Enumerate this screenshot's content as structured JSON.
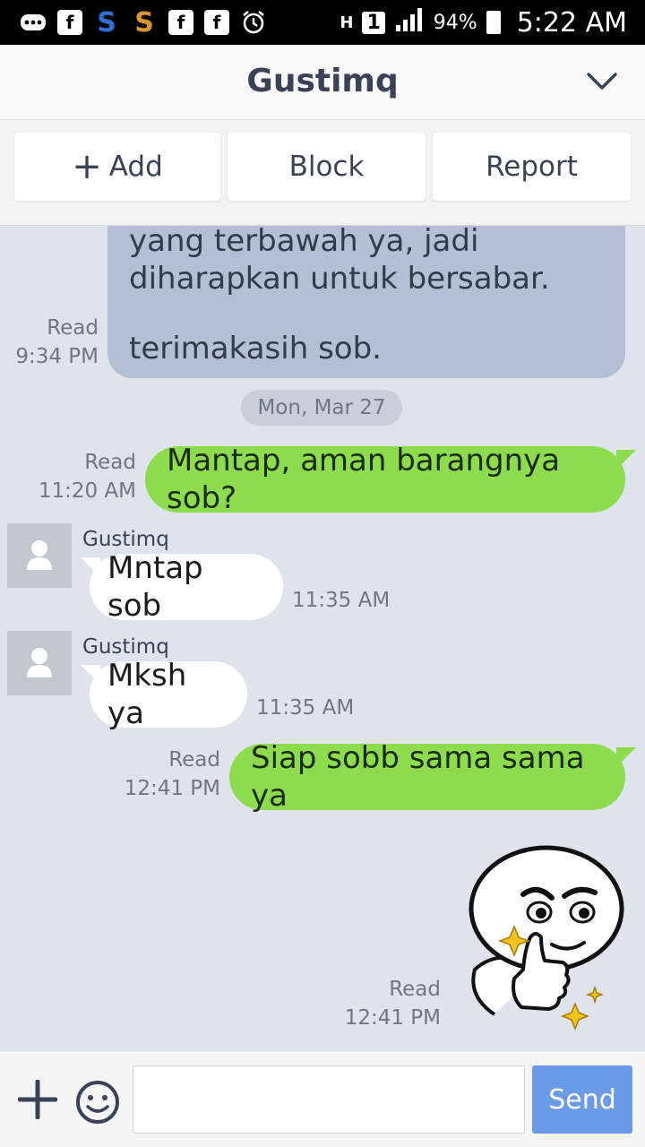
{
  "status_bar": {
    "battery": "94%",
    "time": "5:22 AM",
    "icons": [
      "more-icon",
      "facebook-icon",
      "s-app-icon",
      "s-app-icon",
      "facebook-icon",
      "facebook-icon",
      "alarm-icon",
      "data-icon",
      "sim-icon",
      "signal-icon",
      "battery-icon"
    ],
    "sim": "1",
    "network_letter": "H"
  },
  "header": {
    "title": "Gustimq",
    "chevron": "chevron-down-icon"
  },
  "actions": {
    "add_label": "Add",
    "block_label": "Block",
    "report_label": "Report"
  },
  "chat": {
    "previous_message": {
      "line1": "yang terbawah ya, jadi",
      "line2": "diharapkan untuk bersabar.",
      "line3": "terimakasih sob.",
      "read": "Read",
      "time": "9:34 PM"
    },
    "date_separator": "Mon, Mar 27",
    "messages": [
      {
        "from": "me",
        "text": "Mantap, aman barangnya sob?",
        "read": "Read",
        "time": "11:20 AM"
      },
      {
        "from": "Gustimq",
        "text": "Mntap sob",
        "time": "11:35 AM"
      },
      {
        "from": "Gustimq",
        "text": "Mksh ya",
        "time": "11:35 AM"
      },
      {
        "from": "me",
        "text": "Siap sobb sama sama ya",
        "read": "Read",
        "time": "12:41 PM"
      },
      {
        "from": "me",
        "type": "sticker",
        "sticker": "thumbs-up-sticker",
        "read": "Read",
        "time": "12:41 PM"
      }
    ]
  },
  "input_bar": {
    "placeholder": "",
    "send_label": "Send"
  },
  "colors": {
    "chat_background": "#dfe3eb",
    "outgoing_bubble": "#8ddc4d",
    "incoming_bubble": "#ffffff",
    "previous_bubble": "#b4bfd6",
    "send_button": "#6a9be7",
    "title_text": "#3a4258"
  }
}
